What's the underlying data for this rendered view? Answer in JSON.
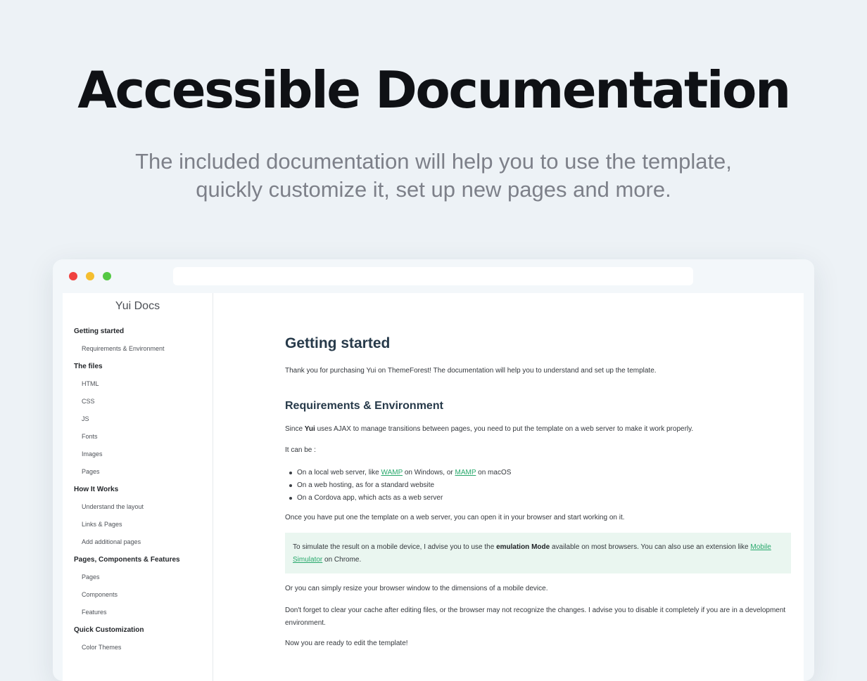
{
  "hero": {
    "title": "Accessible Documentation",
    "subtitle_line1": "The included documentation will help you to use the template,",
    "subtitle_line2": "quickly customize it, set up new pages and more."
  },
  "browser": {
    "window_controls": [
      "close-dot",
      "minimize-dot",
      "maximize-dot"
    ],
    "control_colors": [
      "#f0413f",
      "#f5be2f",
      "#54c843"
    ],
    "url": ""
  },
  "sidebar": {
    "brand": "Yui Docs",
    "items": [
      {
        "label": "Getting started",
        "type": "section"
      },
      {
        "label": "Requirements & Environment",
        "type": "sub"
      },
      {
        "label": "The files",
        "type": "section"
      },
      {
        "label": "HTML",
        "type": "sub"
      },
      {
        "label": "CSS",
        "type": "sub"
      },
      {
        "label": "JS",
        "type": "sub"
      },
      {
        "label": "Fonts",
        "type": "sub"
      },
      {
        "label": "Images",
        "type": "sub"
      },
      {
        "label": "Pages",
        "type": "sub"
      },
      {
        "label": "How It Works",
        "type": "section"
      },
      {
        "label": "Understand the layout",
        "type": "sub"
      },
      {
        "label": "Links & Pages",
        "type": "sub"
      },
      {
        "label": "Add additional pages",
        "type": "sub"
      },
      {
        "label": "Pages, Components & Features",
        "type": "section"
      },
      {
        "label": "Pages",
        "type": "sub"
      },
      {
        "label": "Components",
        "type": "sub"
      },
      {
        "label": "Features",
        "type": "sub"
      },
      {
        "label": "Quick Customization",
        "type": "section"
      },
      {
        "label": "Color Themes",
        "type": "sub"
      }
    ]
  },
  "content": {
    "h1": "Getting started",
    "intro": "Thank you for purchasing Yui on ThemeForest! The documentation will help you to understand and set up the template.",
    "h2": "Requirements & Environment",
    "req_pre": "Since ",
    "req_bold": "Yui",
    "req_post": " uses AJAX to manage transitions between pages, you need to put the template on a web server to make it work properly.",
    "it_can_be": "It can be :",
    "bullet1_pre": "On a local web server, like ",
    "bullet1_link1": "WAMP",
    "bullet1_mid": " on Windows, or ",
    "bullet1_link2": "MAMP",
    "bullet1_post": " on macOS",
    "bullet2": "On a web hosting, as for a standard website",
    "bullet3": "On a Cordova app, which acts as a web server",
    "once": "Once you have put one the template on a web server, you can open it in your browser and start working on it.",
    "callout_pre": "To simulate the result on a mobile device, I advise you to use the ",
    "callout_bold": "emulation Mode",
    "callout_mid": " available on most browsers. You can also use an extension like ",
    "callout_link_a": "Mobile",
    "callout_link_b": "Simulator",
    "callout_post": " on Chrome.",
    "resize": "Or you can simply resize your browser window to the dimensions of a mobile device.",
    "cache_line1": "Don't forget to clear your cache after editing files, or the browser may not recognize the changes. I advise you to disable it completely if you are in a development",
    "cache_line2": "environment.",
    "ready": "Now you are ready to edit the template!"
  },
  "colors": {
    "accent_link": "#27a86b",
    "callout_bg": "#eaf6f0",
    "heading": "#273a4a"
  }
}
